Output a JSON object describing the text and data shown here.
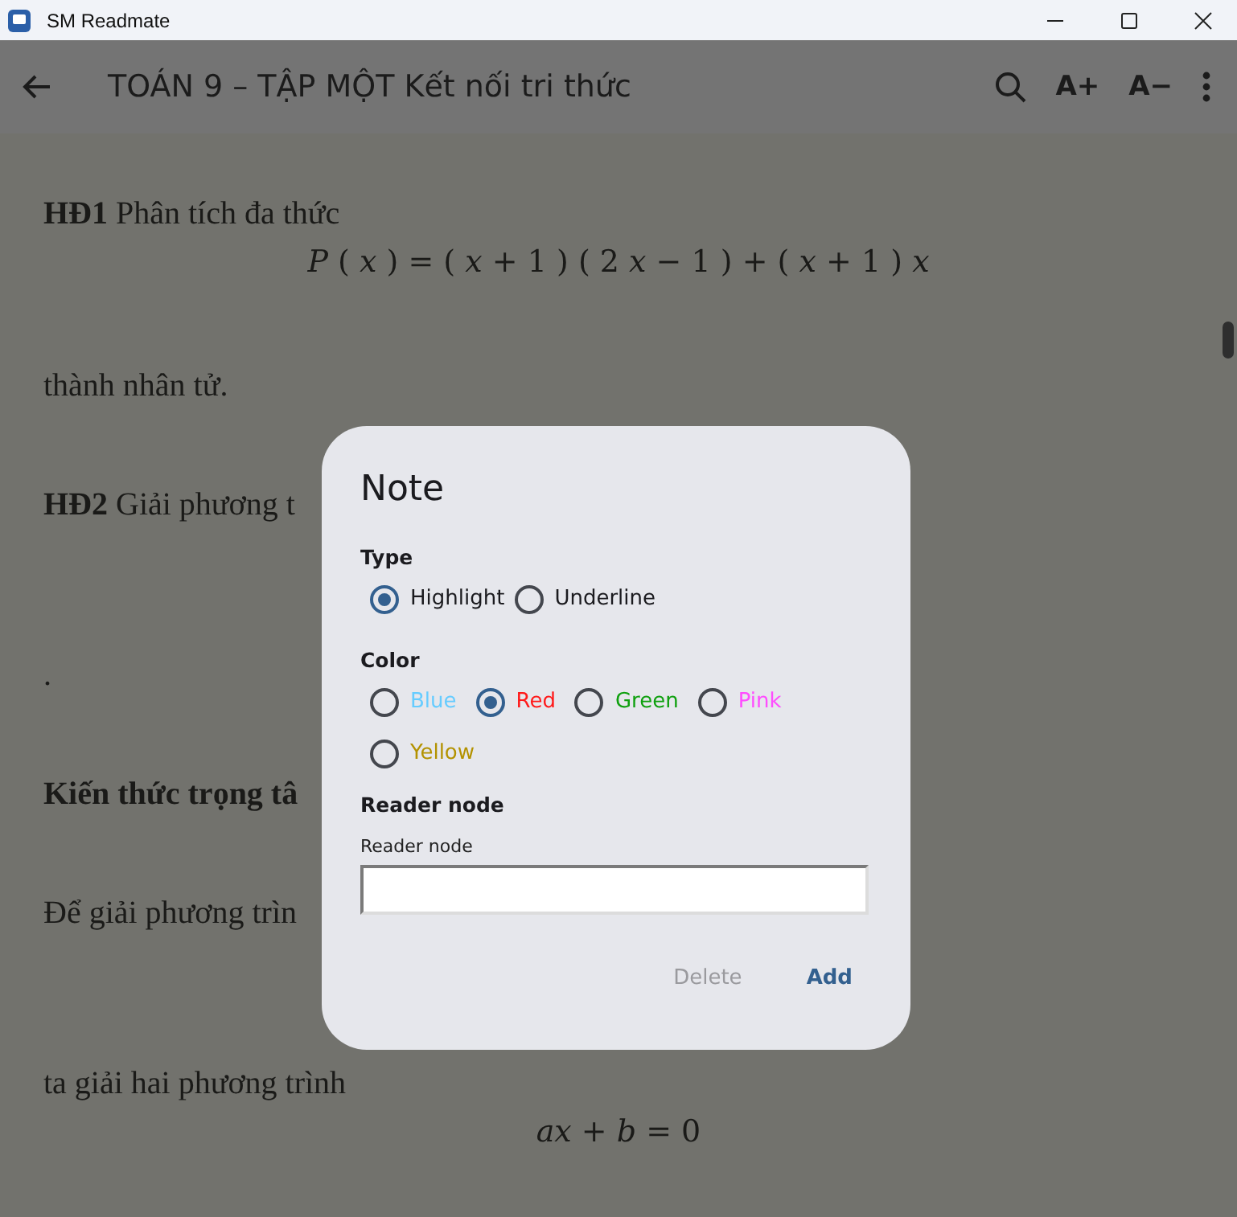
{
  "window": {
    "title": "SM Readmate"
  },
  "app_bar": {
    "title": "TOÁN 9 – TẬP MỘT Kết nối tri thức",
    "font_buttons": [
      "A+",
      "A−"
    ]
  },
  "content": {
    "blocks": [
      {
        "kind": "paragraph",
        "text": "**HĐ1** Phân tích đa thức"
      },
      {
        "kind": "formula",
        "text": "*P* ( *x* ) = ( *x* + 1 ) ( 2 *x* − 1 ) + ( *x* + 1 ) *x*"
      },
      {
        "kind": "paragraph",
        "text": "thành nhân tử."
      },
      {
        "kind": "paragraph",
        "text": "**HĐ2** Giải phương t"
      },
      {
        "kind": "paragraph",
        "text": "."
      },
      {
        "kind": "heading",
        "text": "Kiến thức trọng tâ"
      },
      {
        "kind": "paragraph",
        "text": "Để giải phương trìn"
      },
      {
        "kind": "paragraph",
        "text": "ta giải hai phương trình"
      },
      {
        "kind": "formula",
        "text": "*ax* + *b* = 0"
      }
    ]
  },
  "dialog": {
    "title": "Note",
    "type_label": "Type",
    "type_options": [
      {
        "label": "Highlight",
        "selected": true
      },
      {
        "label": "Underline",
        "selected": false
      }
    ],
    "color_label": "Color",
    "color_options": [
      {
        "label": "Blue",
        "color": "#66ccff",
        "selected": false
      },
      {
        "label": "Red",
        "color": "#ff1a1a",
        "selected": true
      },
      {
        "label": "Green",
        "color": "#0fa00f",
        "selected": false
      },
      {
        "label": "Pink",
        "color": "#ff4dff",
        "selected": false
      },
      {
        "label": "Yellow",
        "color": "#b39200",
        "selected": false
      }
    ],
    "note_label": "Reader node",
    "field_label": "Reader node",
    "buttons": [
      {
        "label": "Delete",
        "disabled": true
      },
      {
        "label": "Add",
        "disabled": false
      }
    ]
  }
}
